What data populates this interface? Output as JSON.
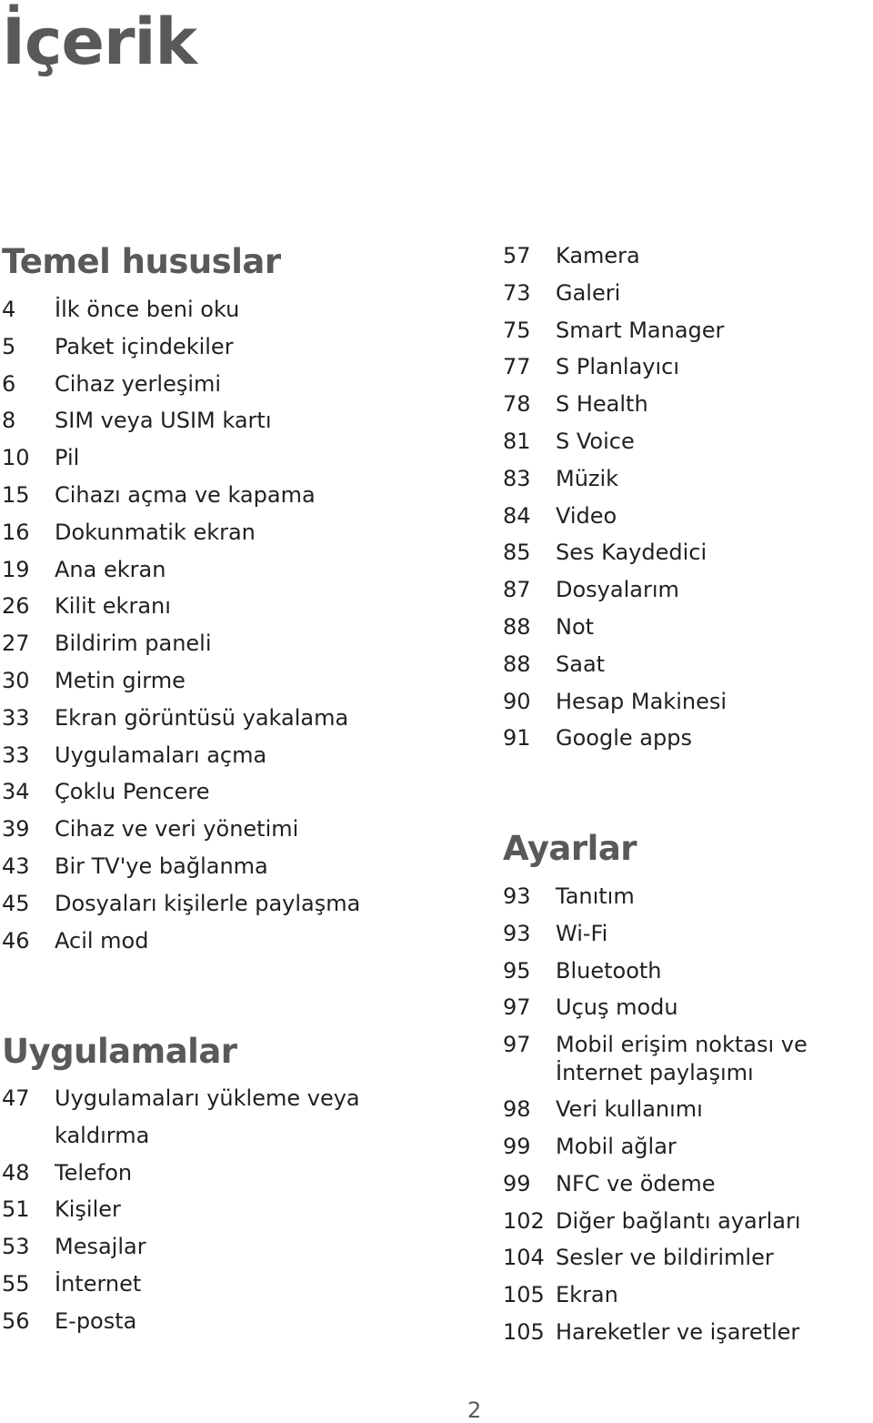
{
  "title": "İçerik",
  "sections": {
    "temel": {
      "heading": "Temel hususlar",
      "items": [
        {
          "page": "4",
          "label": "İlk önce beni oku"
        },
        {
          "page": "5",
          "label": "Paket içindekiler"
        },
        {
          "page": "6",
          "label": "Cihaz yerleşimi"
        },
        {
          "page": "8",
          "label": "SIM veya USIM kartı"
        },
        {
          "page": "10",
          "label": "Pil"
        },
        {
          "page": "15",
          "label": "Cihazı açma ve kapama"
        },
        {
          "page": "16",
          "label": "Dokunmatik ekran"
        },
        {
          "page": "19",
          "label": "Ana ekran"
        },
        {
          "page": "26",
          "label": "Kilit ekranı"
        },
        {
          "page": "27",
          "label": "Bildirim paneli"
        },
        {
          "page": "30",
          "label": "Metin girme"
        },
        {
          "page": "33",
          "label": "Ekran görüntüsü yakalama"
        },
        {
          "page": "33",
          "label": "Uygulamaları açma"
        },
        {
          "page": "34",
          "label": "Çoklu Pencere"
        },
        {
          "page": "39",
          "label": "Cihaz ve veri yönetimi"
        },
        {
          "page": "43",
          "label": "Bir TV'ye bağlanma"
        },
        {
          "page": "45",
          "label": "Dosyaları kişilerle paylaşma"
        },
        {
          "page": "46",
          "label": "Acil mod"
        }
      ]
    },
    "uygulamalar": {
      "heading": "Uygulamalar",
      "items": [
        {
          "page": "47",
          "label": "Uygulamaları yükleme veya kaldırma"
        },
        {
          "page": "48",
          "label": "Telefon"
        },
        {
          "page": "51",
          "label": "Kişiler"
        },
        {
          "page": "53",
          "label": "Mesajlar"
        },
        {
          "page": "55",
          "label": "İnternet"
        },
        {
          "page": "56",
          "label": "E-posta"
        }
      ],
      "continued": [
        {
          "page": "57",
          "label": "Kamera"
        },
        {
          "page": "73",
          "label": "Galeri"
        },
        {
          "page": "75",
          "label": "Smart Manager"
        },
        {
          "page": "77",
          "label": "S Planlayıcı"
        },
        {
          "page": "78",
          "label": "S Health"
        },
        {
          "page": "81",
          "label": "S Voice"
        },
        {
          "page": "83",
          "label": "Müzik"
        },
        {
          "page": "84",
          "label": "Video"
        },
        {
          "page": "85",
          "label": "Ses Kaydedici"
        },
        {
          "page": "87",
          "label": "Dosyalarım"
        },
        {
          "page": "88",
          "label": "Not"
        },
        {
          "page": "88",
          "label": "Saat"
        },
        {
          "page": "90",
          "label": "Hesap Makinesi"
        },
        {
          "page": "91",
          "label": "Google apps"
        }
      ]
    },
    "ayarlar": {
      "heading": "Ayarlar",
      "items": [
        {
          "page": "93",
          "label": "Tanıtım"
        },
        {
          "page": "93",
          "label": "Wi-Fi"
        },
        {
          "page": "95",
          "label": "Bluetooth"
        },
        {
          "page": "97",
          "label": "Uçuş modu"
        },
        {
          "page": "97",
          "label": "Mobil erişim noktası ve İnternet paylaşımı"
        },
        {
          "page": "98",
          "label": "Veri kullanımı"
        },
        {
          "page": "99",
          "label": "Mobil ağlar"
        },
        {
          "page": "99",
          "label": "NFC ve ödeme"
        },
        {
          "page": "102",
          "label": "Diğer bağlantı ayarları"
        },
        {
          "page": "104",
          "label": "Sesler ve bildirimler"
        },
        {
          "page": "105",
          "label": "Ekran"
        },
        {
          "page": "105",
          "label": "Hareketler ve işaretler"
        }
      ]
    }
  },
  "page_number": "2"
}
